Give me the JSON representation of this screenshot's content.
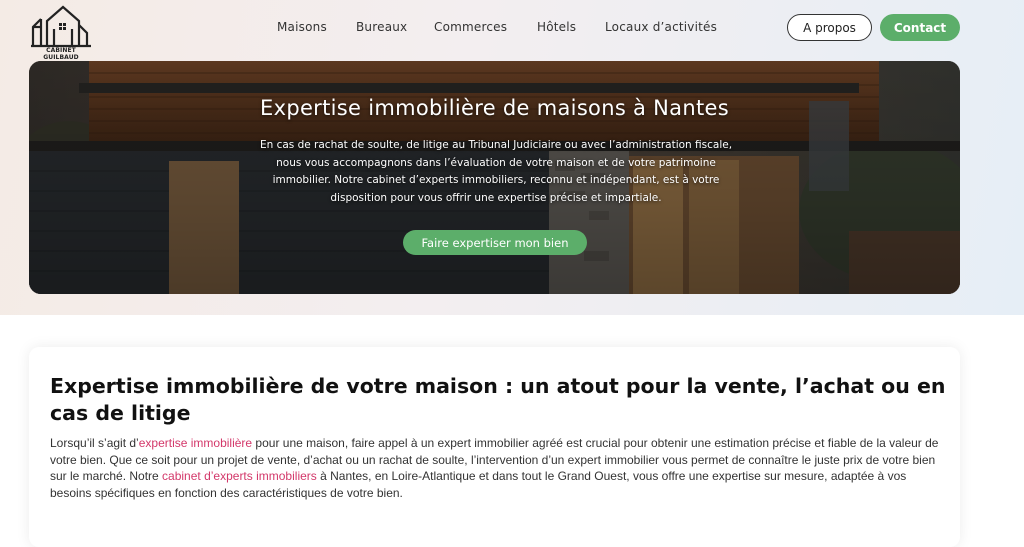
{
  "brand": {
    "name": "CABINET GUILBAUD"
  },
  "nav": {
    "items": [
      "Maisons",
      "Bureaux",
      "Commerces",
      "Hôtels",
      "Locaux d’activités"
    ],
    "about_label": "A propos",
    "contact_label": "Contact"
  },
  "hero": {
    "title": "Expertise immobilière de maisons à Nantes",
    "text": "En cas de rachat de soulte, de litige au Tribunal Judiciaire ou avec l’administration fiscale, nous vous accompagnons dans l’évaluation de votre maison et de votre patrimoine immobilier. Notre cabinet d’experts immobiliers, reconnu et indépendant, est à votre disposition pour vous offrir une expertise précise et impartiale.",
    "cta_label": "Faire expertiser mon bien"
  },
  "article": {
    "title": "Expertise immobilière de votre maison : un atout pour la vente, l’achat ou en cas de litige",
    "p1_before": "Lorsqu’il s’agit d’",
    "p1_link1": "expertise immobilière",
    "p1_middle": " pour une maison, faire appel à un expert immobilier agréé est crucial pour obtenir une estimation précise et fiable de la valeur de votre bien. Que ce soit pour un projet de vente, d’achat ou un rachat de soulte, l’intervention d’un expert immobilier vous permet de connaître le juste prix de votre bien sur le marché. Notre ",
    "p1_link2": "cabinet d’experts immobiliers",
    "p1_after": " à Nantes, en Loire-Atlantique et dans tout le Grand Ouest, vous offre une expertise sur mesure, adaptée à vos besoins spécifiques en fonction des caractéristiques de votre bien."
  },
  "colors": {
    "accent_green": "#5cae6a",
    "link_pink": "#d3386a"
  },
  "icons": {
    "logo": "house-outline-logo-icon"
  }
}
